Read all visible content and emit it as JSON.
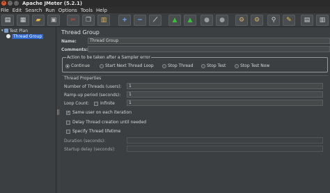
{
  "window": {
    "title": "Apache JMeter (5.2.1)",
    "controls": {
      "close": "×",
      "minimize": "–",
      "maximize": "□"
    }
  },
  "menu": [
    "File",
    "Edit",
    "Search",
    "Run",
    "Options",
    "Tools",
    "Help"
  ],
  "toolbar": {
    "buttons": [
      {
        "name": "new-icon",
        "glyph": "▤",
        "color": "#e8e8e8"
      },
      {
        "name": "templates-icon",
        "glyph": "▦",
        "color": "#d0d0d0"
      },
      {
        "name": "open-icon",
        "glyph": "▰",
        "color": "#e3b542"
      },
      {
        "name": "save-icon",
        "glyph": "▣",
        "color": "#b9b9b9"
      },
      {
        "name": "cut-icon",
        "glyph": "✂",
        "color": "#e04a3a"
      },
      {
        "name": "copy-icon",
        "glyph": "❐",
        "color": "#c8c8c8"
      },
      {
        "name": "paste-icon",
        "glyph": "▥",
        "color": "#d9b35a"
      },
      {
        "name": "expand-icon",
        "glyph": "+",
        "color": "#6fb0ff"
      },
      {
        "name": "collapse-icon",
        "glyph": "−",
        "color": "#6fb0ff"
      },
      {
        "name": "toggle-icon",
        "glyph": "⟋",
        "color": "#c8c8c8"
      },
      {
        "name": "start-icon",
        "glyph": "▲",
        "color": "#38c238"
      },
      {
        "name": "start-no-pauses-icon",
        "glyph": "▲",
        "color": "#38c238"
      },
      {
        "name": "stop-icon",
        "glyph": "●",
        "color": "#9a9a9a"
      },
      {
        "name": "shutdown-icon",
        "glyph": "●",
        "color": "#9a9a9a"
      },
      {
        "name": "clear-icon",
        "glyph": "⚙",
        "color": "#d8b46a"
      },
      {
        "name": "clear-all-icon",
        "glyph": "⚙",
        "color": "#d8b46a"
      },
      {
        "name": "search-icon",
        "glyph": "⚲",
        "color": "#d0d0d0"
      },
      {
        "name": "reset-search-icon",
        "glyph": "✎",
        "color": "#e3c04a"
      },
      {
        "name": "function-helper-icon",
        "glyph": "▤",
        "color": "#cfcfcf"
      },
      {
        "name": "help-icon",
        "glyph": "▥",
        "color": "#cfcfcf"
      }
    ]
  },
  "tree": {
    "items": [
      {
        "label": "Test Plan",
        "selected": false,
        "icon_color": "#7a9ec8"
      },
      {
        "label": "Thread Group",
        "selected": true,
        "icon_color": "#e8e8e8"
      }
    ]
  },
  "panel": {
    "title": "Thread Group",
    "name_label": "Name:",
    "name_value": "Thread Group",
    "comments_label": "Comments:",
    "comments_value": "",
    "error_action": {
      "legend": "Action to be taken after a Sampler error",
      "options": [
        "Continue",
        "Start Next Thread Loop",
        "Stop Thread",
        "Stop Test",
        "Stop Test Now"
      ],
      "selected": "Continue"
    },
    "thread_properties": {
      "heading": "Thread Properties",
      "num_threads_label": "Number of Threads (users):",
      "num_threads_value": "1",
      "rampup_label": "Ramp-up period (seconds):",
      "rampup_value": "1",
      "loop_label": "Loop Count:",
      "infinite_label": "Infinite",
      "loop_value": "1",
      "same_user_label": "Same user on each iteration",
      "same_user_checked": true,
      "delay_label": "Delay Thread creation until needed",
      "delay_checked": false,
      "scheduler_label": "Specify Thread lifetime",
      "scheduler_checked": false,
      "duration_label": "Duration (seconds):",
      "duration_value": "",
      "startup_delay_label": "Startup delay (seconds):",
      "startup_delay_value": ""
    }
  },
  "colors": {
    "selection": "#2f65ca",
    "panel_bg": "#3c3f41",
    "toolbar_bg": "#3b3e40"
  }
}
